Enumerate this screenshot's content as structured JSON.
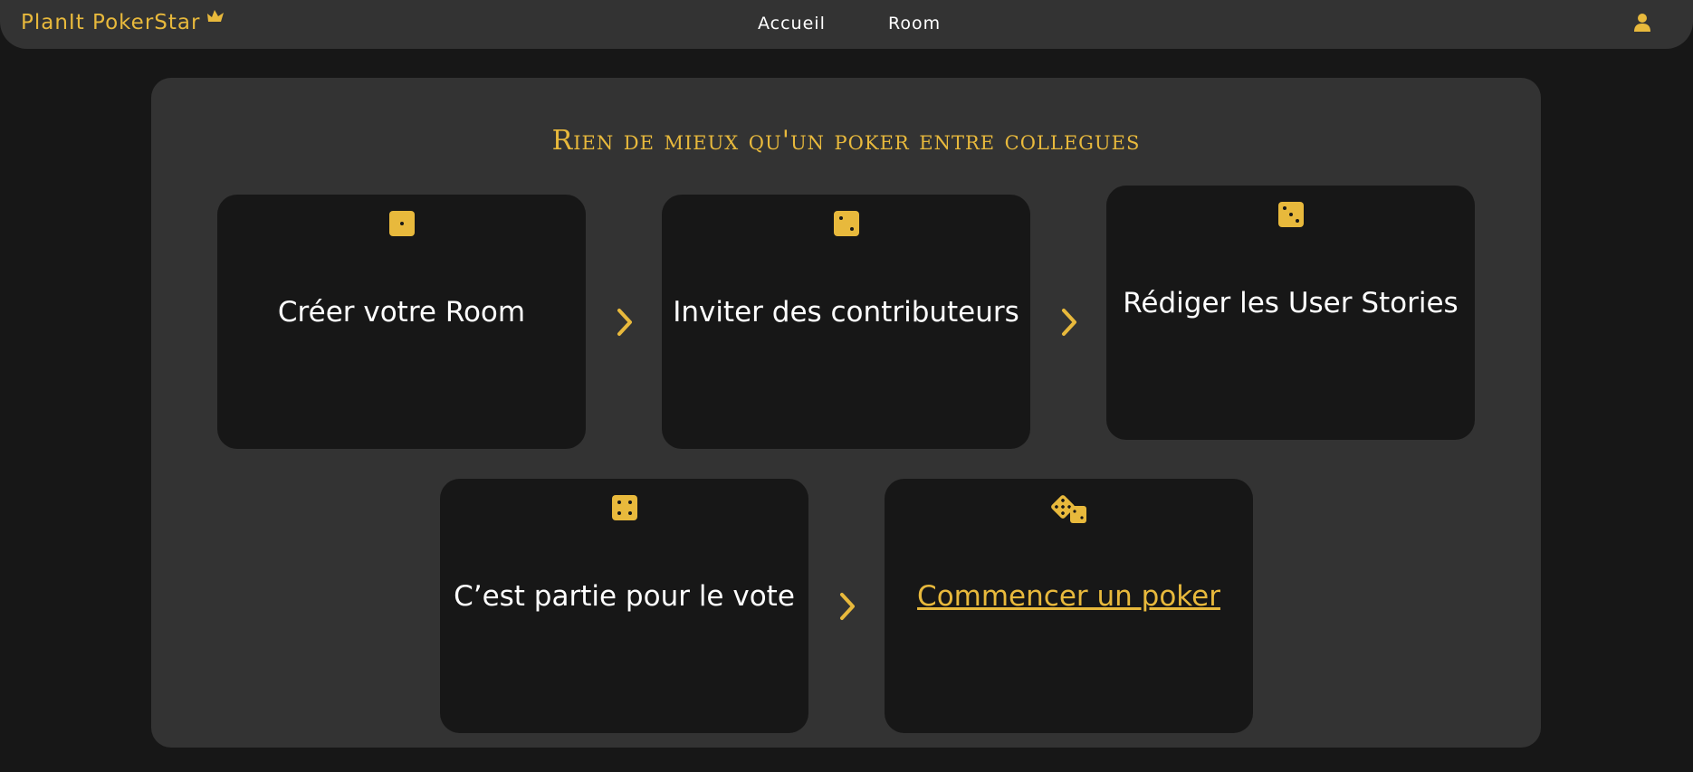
{
  "navbar": {
    "brand": "PlanIt PokerStar",
    "links": [
      "Accueil",
      "Room"
    ]
  },
  "icons": {
    "brand": "crown-icon",
    "user": "user-icon",
    "steps": [
      "dice-one-icon",
      "dice-two-icon",
      "dice-three-icon",
      "dice-four-icon",
      "dice-icon"
    ],
    "arrow": "chevron-right-icon"
  },
  "colors": {
    "accent": "#e8b93c",
    "background": "#171717",
    "surface": "#333333",
    "text": "#ffffff"
  },
  "main": {
    "title": "Rien de mieux qu'un poker entre collegues",
    "steps": [
      {
        "label": "Créer votre Room"
      },
      {
        "label": "Inviter des contributeurs"
      },
      {
        "label": "Rédiger les User Stories"
      },
      {
        "label": "C’est partie pour le vote"
      },
      {
        "label": "Commencer un poker"
      }
    ]
  }
}
